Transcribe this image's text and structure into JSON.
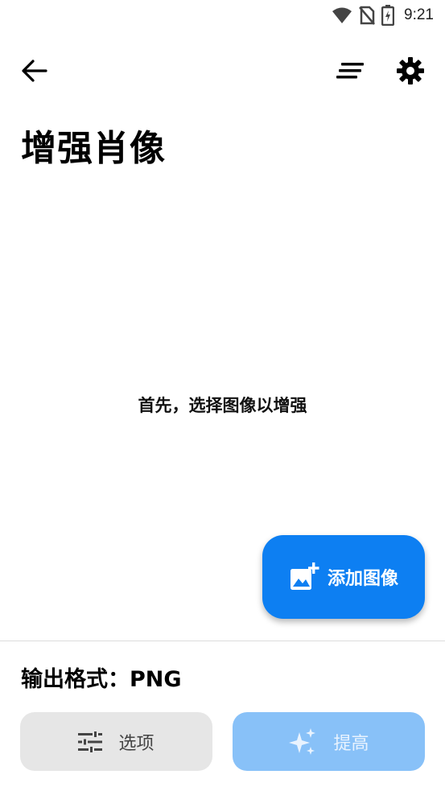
{
  "status_bar": {
    "time": "9:21",
    "icons": [
      "wifi-icon",
      "no-sim-icon",
      "battery-charging-icon"
    ]
  },
  "app_bar": {
    "back_icon": "arrow-left-icon",
    "sort_icon": "sort-icon",
    "settings_icon": "gear-icon"
  },
  "page": {
    "title": "增强肖像",
    "empty_hint": "首先，选择图像以增强"
  },
  "fab": {
    "label": "添加图像",
    "icon": "add-photo-icon",
    "color": "#0d7ff2"
  },
  "footer": {
    "output_format": "输出格式：PNG",
    "options_label": "选项",
    "options_icon": "tune-icon",
    "enhance_label": "提高",
    "enhance_icon": "sparkle-icon",
    "enhance_color": "#88c1f8"
  }
}
